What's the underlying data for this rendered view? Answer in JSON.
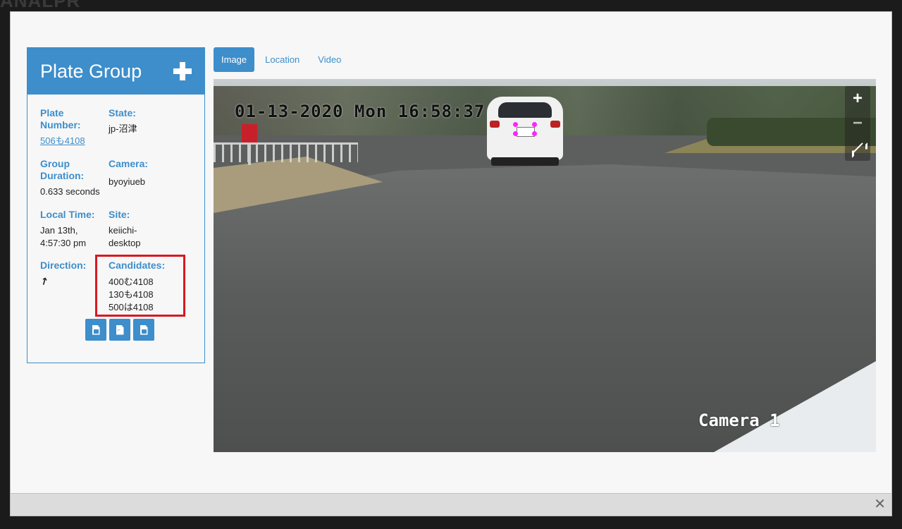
{
  "background": {
    "title_fragment": "ANALPR"
  },
  "panel": {
    "title": "Plate Group",
    "add_icon": "plus-icon",
    "fields": {
      "plate_number": {
        "label": "Plate Number:",
        "value": "506も4108"
      },
      "state": {
        "label": "State:",
        "value": "jp-沼津"
      },
      "group_duration": {
        "label": "Group Duration:",
        "value": "0.633 seconds"
      },
      "camera": {
        "label": "Camera:",
        "value": "byoyiueb"
      },
      "local_time": {
        "label": "Local Time:",
        "value": "Jan 13th, 4:57:30 pm"
      },
      "site": {
        "label": "Site:",
        "value": "keiichi-desktop"
      },
      "direction": {
        "label": "Direction:",
        "value": "↗"
      },
      "candidates": {
        "label": "Candidates:",
        "values": [
          "400む4108",
          "130も4108",
          "500は4108"
        ]
      }
    },
    "buttons": [
      "image-download-icon",
      "pdf-download-icon",
      "video-download-icon"
    ]
  },
  "tabs": [
    {
      "label": "Image",
      "active": true
    },
    {
      "label": "Location",
      "active": false
    },
    {
      "label": "Video",
      "active": false
    }
  ],
  "viewer": {
    "timestamp_overlay": "01-13-2020 Mon 16:58:37",
    "camera_overlay": "Camera  1",
    "zoom_in": "+",
    "zoom_out": "−"
  },
  "footer": {
    "close": "✕"
  },
  "colors": {
    "accent": "#3d8ecb",
    "highlight": "#d71920",
    "plate_points": "#ff23ff"
  }
}
